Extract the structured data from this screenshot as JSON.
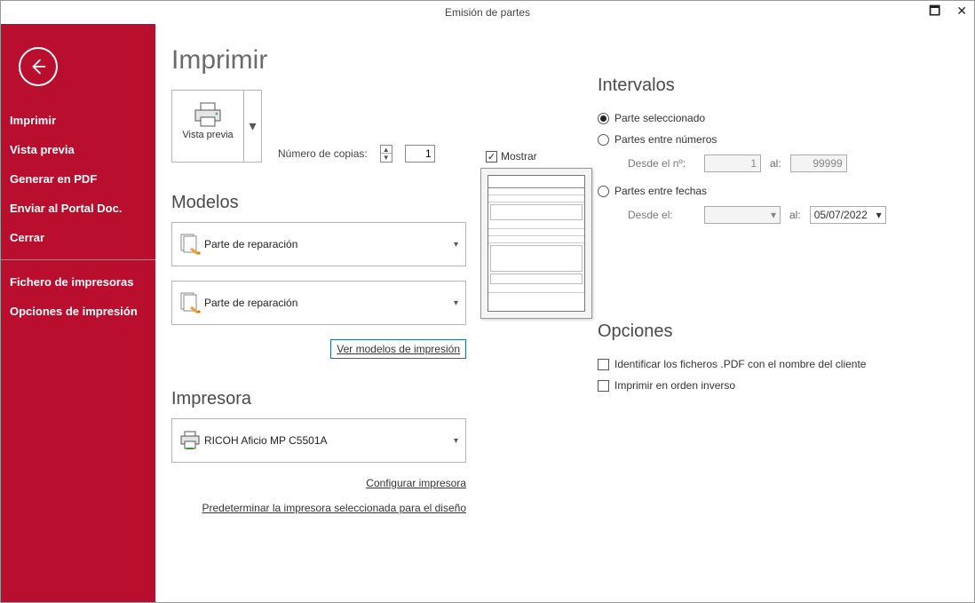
{
  "window": {
    "title": "Emisión de partes"
  },
  "sidebar": {
    "items": [
      {
        "label": "Imprimir"
      },
      {
        "label": "Vista previa"
      },
      {
        "label": "Generar en PDF"
      },
      {
        "label": "Enviar al Portal Doc."
      },
      {
        "label": "Cerrar"
      }
    ],
    "secondary": [
      {
        "label": "Fichero de impresoras"
      },
      {
        "label": "Opciones de impresión"
      }
    ]
  },
  "heading": "Imprimir",
  "preview_btn": {
    "label": "Vista previa"
  },
  "copies": {
    "label": "Número de copias:",
    "value": "1"
  },
  "modelos": {
    "heading": "Modelos",
    "mostrar_label": "Mostrar",
    "combo1": "Parte de reparación",
    "combo2": "Parte de reparación",
    "link": "Ver modelos de impresión"
  },
  "impresora": {
    "heading": "Impresora",
    "selected": "RICOH Aficio MP C5501A",
    "link1": "Configurar impresora",
    "link2": "Predeterminar la impresora seleccionada para el diseño"
  },
  "intervalos": {
    "heading": "Intervalos",
    "r1": "Parte seleccionado",
    "r2": "Partes entre números",
    "r3": "Partes entre fechas",
    "desde_n": "Desde el nº:",
    "desde_n_val": "1",
    "al": "al:",
    "hasta_n_val": "99999",
    "desde_f": "Desde el:",
    "hasta_fecha": "05/07/2022"
  },
  "opciones": {
    "heading": "Opciones",
    "c1": "Identificar los ficheros .PDF con el nombre del cliente",
    "c2": "Imprimir en orden inverso"
  }
}
